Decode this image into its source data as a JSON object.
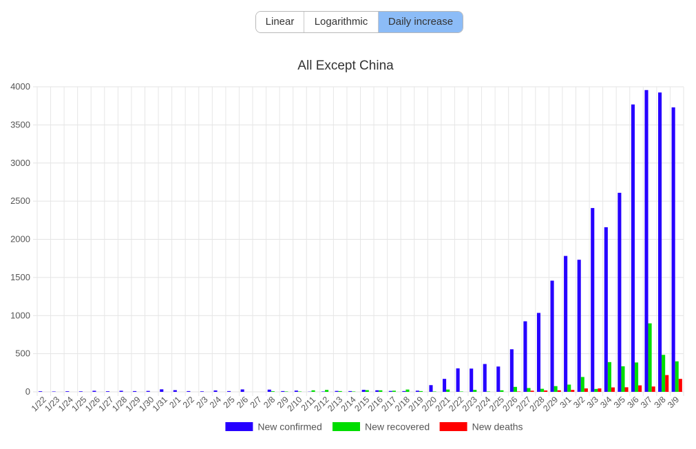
{
  "toolbar": {
    "buttons": [
      "Linear",
      "Logarithmic",
      "Daily increase"
    ],
    "active_index": 2
  },
  "chart_data": {
    "type": "bar",
    "title": "All Except China",
    "xlabel": "",
    "ylabel": "",
    "ylim": [
      0,
      4000
    ],
    "yticks": [
      0,
      500,
      1000,
      1500,
      2000,
      2500,
      3000,
      3500,
      4000
    ],
    "grid": true,
    "legend_position": "bottom",
    "categories": [
      "1/22",
      "1/23",
      "1/24",
      "1/25",
      "1/26",
      "1/27",
      "1/28",
      "1/29",
      "1/30",
      "1/31",
      "2/1",
      "2/2",
      "2/3",
      "2/4",
      "2/5",
      "2/6",
      "2/7",
      "2/8",
      "2/9",
      "2/10",
      "2/11",
      "2/12",
      "2/13",
      "2/14",
      "2/15",
      "2/16",
      "2/17",
      "2/18",
      "2/19",
      "2/20",
      "2/21",
      "2/22",
      "2/23",
      "2/24",
      "2/25",
      "2/26",
      "2/27",
      "2/28",
      "2/29",
      "3/1",
      "3/2",
      "3/3",
      "3/4",
      "3/5",
      "3/6",
      "3/7",
      "3/8",
      "3/9"
    ],
    "series": [
      {
        "name": "New confirmed",
        "color": "#2600ff",
        "values": [
          8,
          5,
          8,
          7,
          14,
          8,
          14,
          10,
          12,
          33,
          22,
          10,
          7,
          18,
          10,
          32,
          0,
          29,
          10,
          16,
          3,
          5,
          12,
          10,
          26,
          20,
          12,
          10,
          15,
          88,
          170,
          308,
          305,
          365,
          332,
          558,
          925,
          1035,
          1458,
          1782,
          1732,
          2410,
          2158,
          2610,
          3768,
          3957,
          3925,
          3730
        ]
      },
      {
        "name": "New recovered",
        "color": "#00dd00",
        "values": [
          0,
          0,
          0,
          0,
          0,
          0,
          0,
          0,
          0,
          0,
          0,
          0,
          0,
          0,
          0,
          0,
          0,
          8,
          5,
          5,
          20,
          25,
          10,
          5,
          22,
          20,
          15,
          30,
          10,
          5,
          30,
          5,
          25,
          5,
          20,
          65,
          50,
          40,
          75,
          95,
          195,
          38,
          390,
          335,
          385,
          898,
          485,
          400
        ]
      },
      {
        "name": "New deaths",
        "color": "#ff0000",
        "values": [
          0,
          0,
          0,
          0,
          0,
          0,
          0,
          0,
          0,
          0,
          0,
          0,
          0,
          0,
          0,
          0,
          0,
          0,
          0,
          0,
          0,
          0,
          0,
          0,
          0,
          0,
          0,
          0,
          0,
          0,
          0,
          0,
          0,
          0,
          0,
          5,
          15,
          18,
          20,
          25,
          45,
          45,
          58,
          60,
          85,
          70,
          220,
          170
        ]
      }
    ]
  }
}
